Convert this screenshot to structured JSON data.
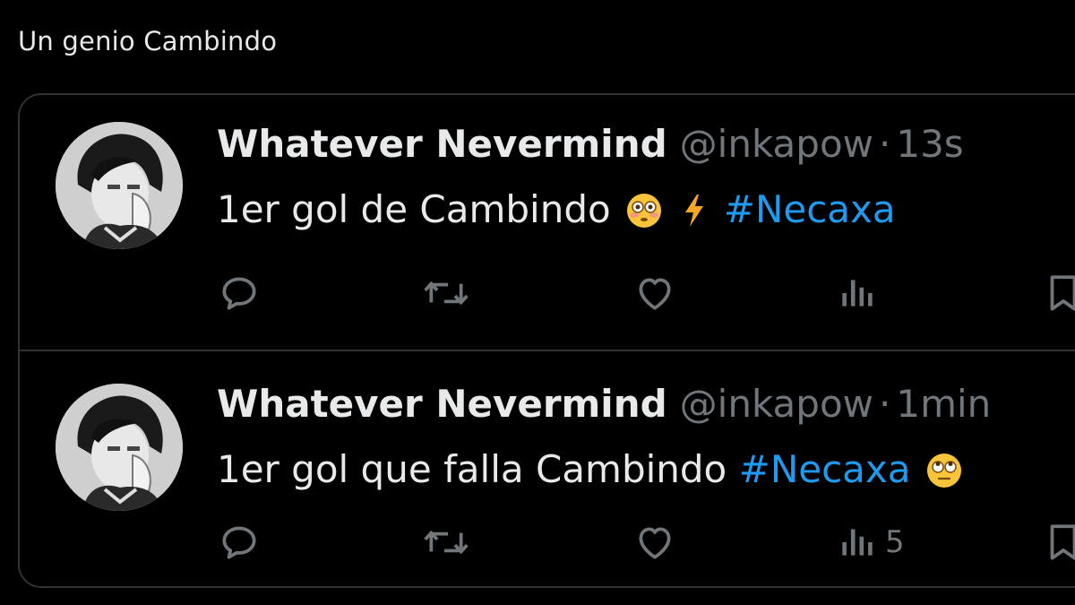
{
  "post": {
    "text": "Un genio Cambindo"
  },
  "quoted": [
    {
      "display_name": "Whatever Nevermind",
      "handle": "@inkapow",
      "separator": "·",
      "time": "13s",
      "text_before": "1er gol de Cambindo",
      "emojis": [
        "flushed-face",
        "high-voltage"
      ],
      "hashtag": "#Necaxa",
      "views": ""
    },
    {
      "display_name": "Whatever Nevermind",
      "handle": "@inkapow",
      "separator": "·",
      "time": "1min",
      "text_before": "1er gol que falla Cambindo",
      "emojis": [
        "face-with-rolling-eyes"
      ],
      "hashtag": "#Necaxa",
      "views": "5"
    }
  ],
  "colors": {
    "background": "#000000",
    "text": "#e7e9ea",
    "muted": "#71767b",
    "link": "#1d9bf0",
    "border": "#2f3336"
  },
  "icons": [
    "reply-icon",
    "retweet-icon",
    "like-icon",
    "views-icon",
    "bookmark-icon"
  ]
}
